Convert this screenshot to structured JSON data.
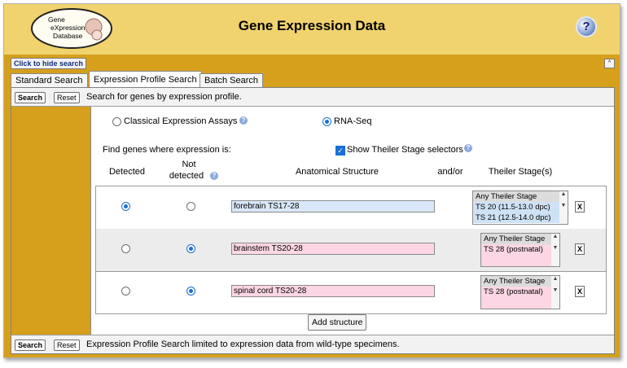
{
  "app": {
    "title": "Gene Expression Data",
    "logo_lines": [
      "Gene",
      "eXpression",
      "Database"
    ],
    "help_icon": "question-icon"
  },
  "controls": {
    "hide_search": "Click to hide search",
    "collapse": "^"
  },
  "tabs": [
    {
      "label": "Standard Search",
      "active": false
    },
    {
      "label": "Expression Profile Search",
      "active": true
    },
    {
      "label": "Batch Search",
      "active": false
    }
  ],
  "top_row": {
    "search": "Search",
    "reset": "Reset",
    "text": "Search for genes by expression profile."
  },
  "assay_options": {
    "classical": "Classical Expression Assays",
    "rnaseq": "RNA-Seq",
    "selected": "RNA-Seq"
  },
  "find_text": "Find genes where expression is:",
  "show_theiler": {
    "label": "Show Theiler Stage selectors",
    "checked": true
  },
  "columns": {
    "detected": "Detected",
    "not_detected_1": "Not",
    "not_detected_2": "detected",
    "anatomical": "Anatomical Structure",
    "andor": "and/or",
    "theiler": "Theiler Stage(s)"
  },
  "structures": [
    {
      "value": "forebrain TS17-28",
      "detected": true,
      "stages": [
        "Any Theiler Stage",
        "TS 20 (11.5-13.0 dpc)",
        "TS 21 (12.5-14.0 dpc)"
      ]
    },
    {
      "value": "brainstem TS20-28",
      "detected": false,
      "stages": [
        "Any Theiler Stage",
        "TS 28 (postnatal)"
      ]
    },
    {
      "value": "spinal cord TS20-28",
      "detected": false,
      "stages": [
        "Any Theiler Stage",
        "TS 28 (postnatal)"
      ]
    }
  ],
  "remove_label": "X",
  "add_structure": "Add structure",
  "bottom_row": {
    "search": "Search",
    "reset": "Reset",
    "text": "Expression Profile Search limited to expression data from wild-type specimens."
  },
  "colors": {
    "header": "#f0d36e",
    "band": "#d6a01d",
    "detected_field": "#d8e8f8",
    "not_detected_field": "#fcd6e4",
    "accent": "#1a6fd4"
  }
}
